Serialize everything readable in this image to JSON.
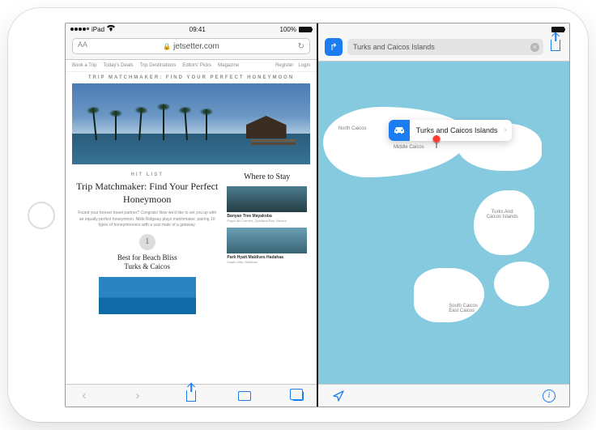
{
  "statusbar": {
    "carrier": "iPad",
    "time": "09:41",
    "battery_pct": "100%"
  },
  "safari": {
    "url": "jetsetter.com",
    "site_nav_left": [
      "Book a Trip",
      "Today's Deals",
      "Trip Destinations",
      "Editors' Picks",
      "Magazine"
    ],
    "site_nav_right": [
      "Register",
      "Login"
    ],
    "eyebrow": "TRIP MATCHMAKER: FIND YOUR PERFECT HONEYMOON",
    "hitlist_label": "HIT LIST",
    "hitlist_title": "Trip Matchmaker: Find Your Perfect Honeymoon",
    "hitlist_desc": "Found your forever travel partner? Congrats! Now we'd like to set you up with an equally perfect honeymoon. Nikki Ridgway plays matchmaker, pairing 10 types of honeymooners with a soul mate of a getaway.",
    "rank": "1",
    "rank_title": "Best for Beach Bliss\nTurks & Caicos",
    "side_title": "Where to Stay",
    "side_items": [
      {
        "name": "Banyan Tree Mayakoba",
        "loc": "Playa del Carmen, Quintana Roo, Mexico"
      },
      {
        "name": "Park Hyatt Maldives Hadahaa",
        "loc": "Gaafu Alifu, Maldives"
      }
    ]
  },
  "maps": {
    "search_value": "Turks and Caicos Islands",
    "callout_title": "Turks and Caicos Islands",
    "labels": {
      "north_caicos": "North Caicos",
      "middle_caicos": "Middle Caicos",
      "turks_caicos": "Turks And\nCaicos Islands",
      "south_caicos": "South Caicos\nEast Caicos"
    },
    "info_glyph": "i"
  }
}
